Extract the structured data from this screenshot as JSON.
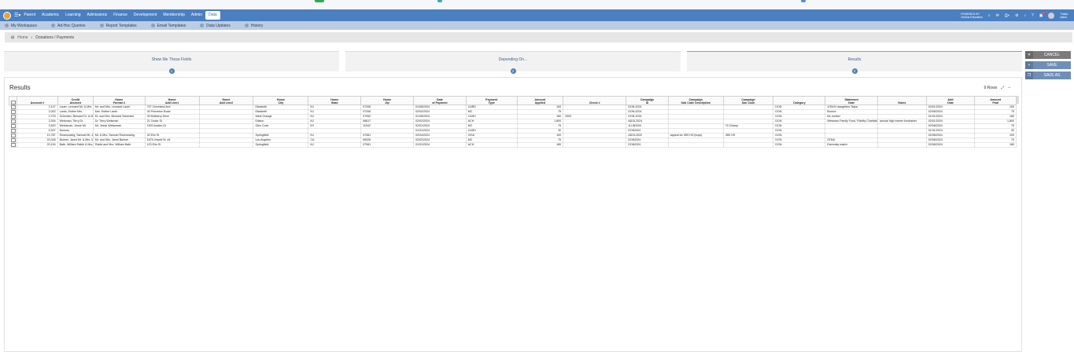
{
  "nav": {
    "items": [
      "Parent",
      "Academic",
      "Learning",
      "Admissions",
      "Finance",
      "Development",
      "Membership",
      "Admin",
      "Data"
    ],
    "active": "Data",
    "powered": [
      "POWERED BY",
      "Genius Education"
    ],
    "user": [
      "Thalia",
      "Mack"
    ],
    "badge": "2"
  },
  "subnav": {
    "items": [
      "My Workspace",
      "Ad-Hoc Queries",
      "Report Templates",
      "Email Templates",
      "Data Updates",
      "History"
    ]
  },
  "breadcrumb": {
    "home": "Home",
    "current": "Donations / Payments"
  },
  "steps": [
    {
      "label": "Show Me These Fields",
      "num": "1"
    },
    {
      "label": "Depending On...",
      "num": "2"
    },
    {
      "label": "Results",
      "num": "3"
    }
  ],
  "buttons": {
    "cancel": "CANCEL",
    "save": "SAVE",
    "save_as": "SAVE AS"
  },
  "results": {
    "title": "Results",
    "rows_label": "9 Rows",
    "columns": [
      "Account #",
      "Credit\nAccount",
      "Home\nFormat 3",
      "Home\nAdd Line1",
      "Home\nAdd Line2",
      "Home\nCity",
      "Home\nState",
      "Home\nZip",
      "Date\nof Payment",
      "Payment\nType",
      "Amount\nApplied",
      "Check #",
      "Campaign\nID",
      "Campaign\nSub Code Description",
      "Campaign\nSub Code",
      "Category",
      "Statement\nNote",
      "Notes",
      "Add\nDate",
      "Amount\nPaid"
    ],
    "rows": [
      [
        "2,147",
        "Lauer, Leonard Mr. & Mrs. Aimee",
        "Mr. and Mrs. Leonard Lauer",
        "707 Cleveland Ave",
        "",
        "Elizabeth",
        "NJ",
        "07208",
        "01/08/2024",
        "CARD",
        "100",
        "",
        "DON-2024",
        "",
        "",
        "DON",
        "1/25/24 daughters Tatya",
        "",
        "02/01/2024",
        "100"
      ],
      [
        "2,002",
        "Lamb, Esther Mrs.",
        "Mrs. Esther Lamb",
        "44 Princeton Road",
        "",
        "Elizabeth",
        "NJ",
        "07208",
        "02/02/2024",
        "MC",
        "75",
        "",
        "DON-2024",
        "",
        "",
        "DON",
        "Brunch",
        "",
        "02/08/2024",
        "75"
      ],
      [
        "2,703",
        "Schenker, Bernard Dr. & Mrs. Judith",
        "Dr. and Mrs. Bernard Schenker",
        "33 Mulberry Drive",
        "",
        "West Orange",
        "NJ",
        "07052",
        "01/28/2024",
        "CASH",
        "180",
        "3303",
        "DON-2024",
        "",
        "",
        "DON",
        "his mother",
        "",
        "01/31/2024",
        "180"
      ],
      [
        "3,304",
        "Weisman, Terry Dr.",
        "Dr. Terry Weisman",
        "21 Cedar St",
        "",
        "Edison",
        "NJ",
        "08817",
        "02/02/2024",
        "ACH",
        "1,800",
        "",
        "ADOL2024",
        "",
        "",
        "DON",
        "Weisman Family Fund, Fidelity Charitable",
        "annual high earner fundraiser",
        "02/01/2024",
        "1,800"
      ],
      [
        "3,520",
        "Weissman, Jesse Mr.",
        "Mr. Jesse Weissman",
        "1520 Avalon Dr",
        "",
        "Glen Cove",
        "NY",
        "11542",
        "02/01/2024",
        "MC",
        "75",
        "",
        "JLUN2024",
        "",
        "74 Champ",
        "DON",
        "",
        "",
        "02/08/2024",
        "75"
      ],
      [
        "5,307",
        "Dunnes",
        "",
        "",
        "",
        "",
        "",
        "",
        "01/31/2024",
        "CASH",
        "30",
        "",
        "DON2024",
        "",
        "",
        "DON",
        "",
        "",
        "01/31/2024",
        "30"
      ],
      [
        "10,787",
        "Rosenzweig, Samuel Mr. & Mrs. Deborah",
        "Mr. & Mrs. Samuel Rosenzweig",
        "32 Elm St",
        "",
        "Springfield",
        "NJ",
        "07081",
        "02/04/2024",
        "VISA",
        "100",
        "",
        "ADOL2022",
        "appeal for JBS HS (boys)",
        "JBS HS",
        "DON",
        "",
        "",
        "02/08/2024",
        "100"
      ],
      [
        "20,028",
        "Bulmer, Jared Mr. & Mrs. Marie",
        "Mr. and Mrs. Jared Bulmer",
        "1575 Jewett St. #4",
        "",
        "Los Angeles",
        "CA",
        "90028",
        "02/02/2024",
        "MC",
        "75",
        "",
        "DON2024",
        "",
        "",
        "DON",
        "STMU",
        "",
        "02/08/2024",
        "75"
      ],
      [
        "20,154",
        "Bath, William Rabbi & Mrs. Shulamit",
        "Rabbi and Mrs. William Bath",
        "123 Elm St",
        "",
        "Springfield",
        "NJ",
        "07081",
        "01/31/2024",
        "ACH",
        "180",
        "",
        "DON2024",
        "",
        "",
        "DON",
        "Extremity match",
        "",
        "02/08/2024",
        "180"
      ]
    ]
  },
  "colors": {
    "nav": "#4a7fc0",
    "subnav": "#bccde3",
    "step_num": "#4a7fc0",
    "btn_gray": "#7b7b7b",
    "btn_blue": "#6e8fb8"
  },
  "icons": [
    "app-logo-icon",
    "grid-icon",
    "home-icon",
    "search-icon",
    "mail-icon",
    "print-icon",
    "bell-icon",
    "help-icon",
    "close-icon",
    "save-icon",
    "copy-icon",
    "expand-icon",
    "collapse-icon"
  ]
}
